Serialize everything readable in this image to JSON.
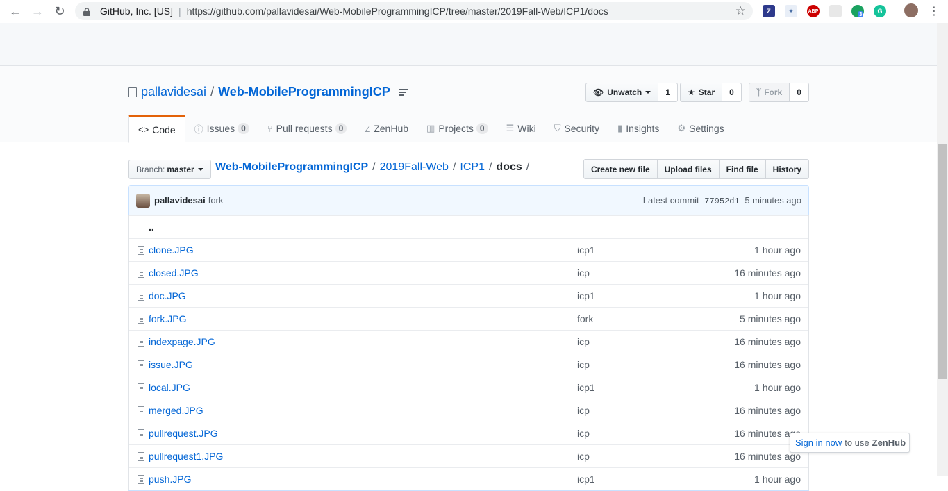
{
  "browser": {
    "site_identity": "GitHub, Inc. [US]",
    "url": "https://github.com/pallavidesai/Web-MobileProgrammingICP/tree/master/2019Fall-Web/ICP1/docs",
    "extensions": [
      "zotero-icon",
      "feather-icon",
      "adblock-icon",
      "blank-extension-icon",
      "notification-badge-icon",
      "grammarly-icon"
    ],
    "extension_badge": "3",
    "abp_label": "ABP"
  },
  "repo": {
    "owner": "pallavidesai",
    "separator": "/",
    "name": "Web-MobileProgrammingICP",
    "unwatch_label": "Unwatch",
    "watch_count": "1",
    "star_label": "Star",
    "star_count": "0",
    "fork_label": "Fork",
    "fork_count": "0"
  },
  "tabs": [
    {
      "label": "Code",
      "icon": "<>",
      "count": null
    },
    {
      "label": "Issues",
      "icon": "ⓘ",
      "count": "0"
    },
    {
      "label": "Pull requests",
      "icon": "⑂",
      "count": "0"
    },
    {
      "label": "ZenHub",
      "icon": "Z",
      "count": null
    },
    {
      "label": "Projects",
      "icon": "▥",
      "count": "0"
    },
    {
      "label": "Wiki",
      "icon": "☰",
      "count": null
    },
    {
      "label": "Security",
      "icon": "⛉",
      "count": null
    },
    {
      "label": "Insights",
      "icon": "▮",
      "count": null
    },
    {
      "label": "Settings",
      "icon": "⚙",
      "count": null
    }
  ],
  "branch": {
    "label": "Branch:",
    "value": "master"
  },
  "breadcrumb": {
    "root": "Web-MobileProgrammingICP",
    "parts": [
      "2019Fall-Web",
      "ICP1"
    ],
    "current": "docs",
    "separator": "/"
  },
  "file_actions": [
    "Create new file",
    "Upload files",
    "Find file",
    "History"
  ],
  "commit": {
    "author": "pallavidesai",
    "message": "fork",
    "latest_label": "Latest commit",
    "sha": "77952d1",
    "age": "5 minutes ago"
  },
  "parent_dir": "..",
  "files": [
    {
      "name": "clone.JPG",
      "message": "icp1",
      "age": "1 hour ago"
    },
    {
      "name": "closed.JPG",
      "message": "icp",
      "age": "16 minutes ago"
    },
    {
      "name": "doc.JPG",
      "message": "icp1",
      "age": "1 hour ago"
    },
    {
      "name": "fork.JPG",
      "message": "fork",
      "age": "5 minutes ago"
    },
    {
      "name": "indexpage.JPG",
      "message": "icp",
      "age": "16 minutes ago"
    },
    {
      "name": "issue.JPG",
      "message": "icp",
      "age": "16 minutes ago"
    },
    {
      "name": "local.JPG",
      "message": "icp1",
      "age": "1 hour ago"
    },
    {
      "name": "merged.JPG",
      "message": "icp",
      "age": "16 minutes ago"
    },
    {
      "name": "pullrequest.JPG",
      "message": "icp",
      "age": "16 minutes ago"
    },
    {
      "name": "pullrequest1.JPG",
      "message": "icp",
      "age": "16 minutes ago"
    },
    {
      "name": "push.JPG",
      "message": "icp1",
      "age": "1 hour ago"
    }
  ],
  "zenhub_popup": {
    "link": "Sign in now",
    "middle": "to use",
    "brand": "ZenHub"
  }
}
